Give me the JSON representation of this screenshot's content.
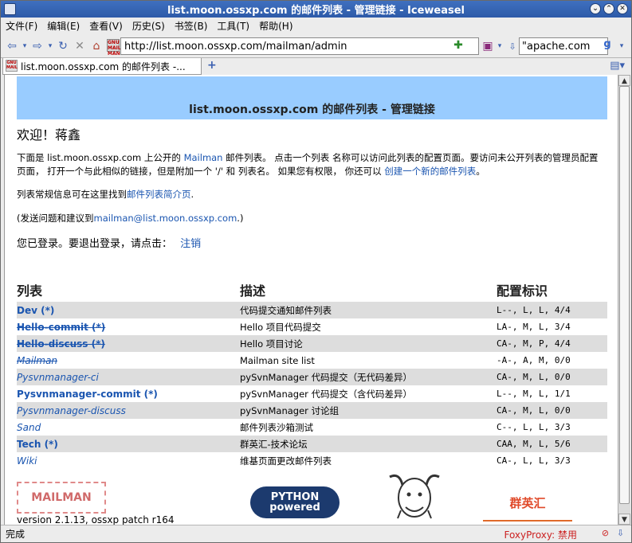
{
  "window": {
    "title": "list.moon.ossxp.com 的邮件列表 - 管理链接 - Iceweasel",
    "controls": [
      "⌄",
      "⌃",
      "✕"
    ]
  },
  "menu": {
    "items": [
      "文件(F)",
      "编辑(E)",
      "查看(V)",
      "历史(S)",
      "书签(B)",
      "工具(T)",
      "帮助(H)"
    ]
  },
  "nav": {
    "url": "http://list.moon.ossxp.com/mailman/admin",
    "search_value": "\"apache.com",
    "urlicon_text": "GNU MAIL MAN"
  },
  "tab": {
    "label": "list.moon.ossxp.com 的邮件列表 -...",
    "new_tab": "+"
  },
  "page": {
    "banner": "list.moon.ossxp.com 的邮件列表 - 管理链接",
    "welcome": "欢迎！蒋鑫",
    "intro_a": "下面是 list.moon.ossxp.com 上公开的 ",
    "intro_mailman_link": "Mailman",
    "intro_b": " 邮件列表。 点击一个列表 名称可以访问此列表的配置页面。要访问未公开列表的管理员配置页面， 打开一个与此相似的链接，但是附加一个 '/' 和 列表名。 如果您有权限， 你还可以 ",
    "intro_create_link": "创建一个新的邮件列表",
    "intro_c": "。",
    "info_a": "列表常规信息可在这里找到",
    "info_link": "邮件列表简介页",
    "info_b": ".",
    "contact_a": "(发送问题和建议到",
    "contact_link": "mailman@list.moon.ossxp.com",
    "contact_b": ".)",
    "logged_in": "您已登录。要退出登录，请点击：",
    "logout_link": "注销",
    "version": "version 2.1.13, ossxp patch r164"
  },
  "table": {
    "headers": [
      "列表",
      "描述",
      "配置标识"
    ],
    "rows": [
      {
        "name": "Dev (*)",
        "style": "bold",
        "desc": "代码提交通知邮件列表",
        "flags": "L--, L, L, 4/4"
      },
      {
        "name": "Hello-commit (*)",
        "style": "bold-strike",
        "desc": "Hello 项目代码提交",
        "flags": "LA-, M, L, 3/4"
      },
      {
        "name": "Hello-discuss (*)",
        "style": "bold-strike",
        "desc": "Hello 项目讨论",
        "flags": "CA-, M, P, 4/4"
      },
      {
        "name": "Mailman",
        "style": "italic-strike",
        "desc": "Mailman site list",
        "flags": "-A-, A, M, 0/0"
      },
      {
        "name": "Pysvnmanager-ci",
        "style": "italic",
        "desc": "pySvnManager 代码提交（无代码差异）",
        "flags": "CA-, M, L, 0/0"
      },
      {
        "name": "Pysvnmanager-commit (*)",
        "style": "bold",
        "desc": "pySvnManager 代码提交（含代码差异）",
        "flags": "L--, M, L, 1/1"
      },
      {
        "name": "Pysvnmanager-discuss",
        "style": "italic",
        "desc": "pySvnManager 讨论组",
        "flags": "CA-, M, L, 0/0"
      },
      {
        "name": "Sand",
        "style": "italic",
        "desc": "邮件列表沙箱测试",
        "flags": "C--, L, L, 3/3"
      },
      {
        "name": "Tech (*)",
        "style": "bold",
        "desc": "群英汇-技术论坛",
        "flags": "CAA, M, L, 5/6"
      },
      {
        "name": "Wiki",
        "style": "italic",
        "desc": "维基页面更改邮件列表",
        "flags": "CA-, L, L, 3/3"
      }
    ]
  },
  "logos": {
    "mailman": "MAILMAN",
    "python": "PYTHON powered",
    "cn": "群英汇"
  },
  "status": {
    "text": "完成",
    "foxy": "FoxyProxy: 禁用"
  },
  "colors": {
    "banner": "#99ccff",
    "link": "#1a55b0",
    "row_alt": "#dddddd"
  }
}
